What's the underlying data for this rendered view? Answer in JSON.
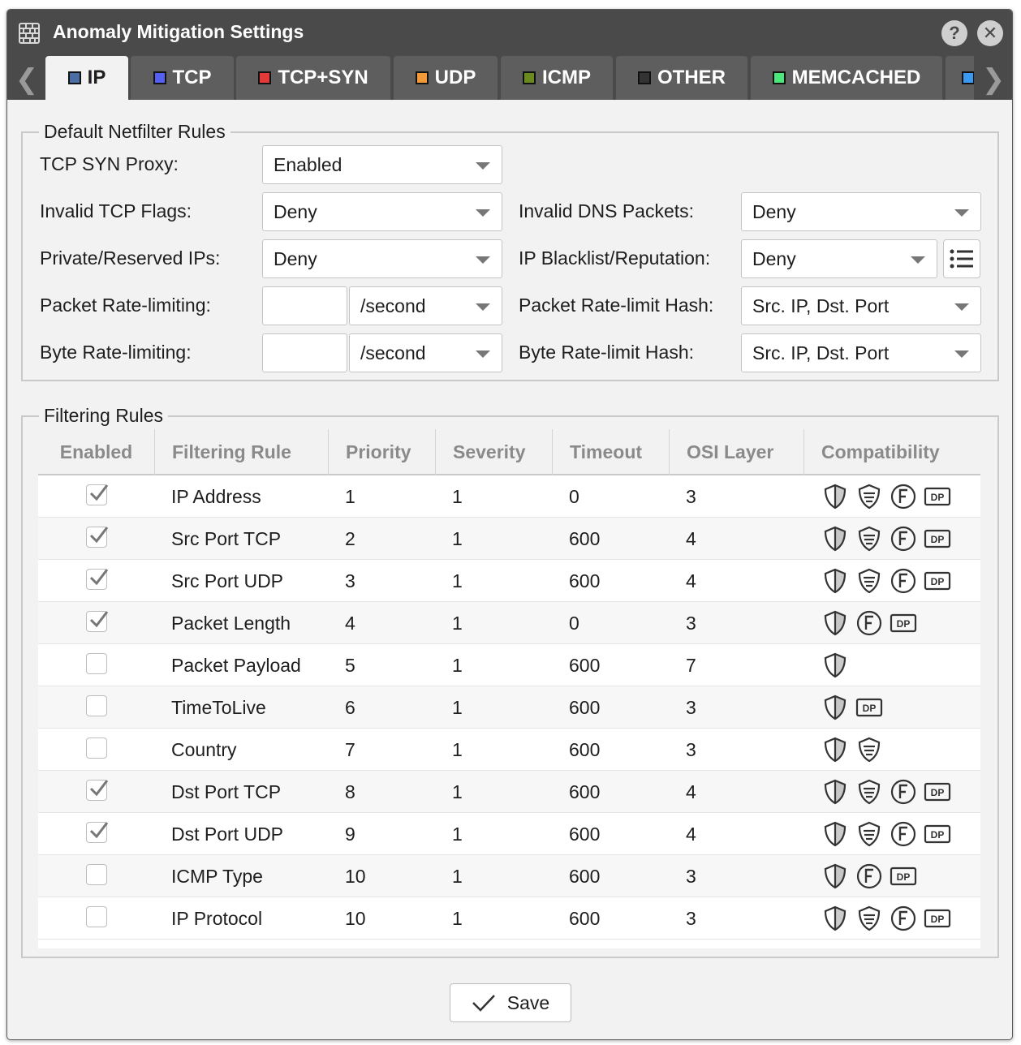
{
  "window": {
    "title": "Anomaly Mitigation Settings"
  },
  "titlebar": {
    "help_label": "?",
    "close_label": "✕"
  },
  "tabs": [
    {
      "label": "IP",
      "color": "#4a6ea3",
      "active": true
    },
    {
      "label": "TCP",
      "color": "#5560f0"
    },
    {
      "label": "TCP+SYN",
      "color": "#e23a3a"
    },
    {
      "label": "UDP",
      "color": "#f29a3a"
    },
    {
      "label": "ICMP",
      "color": "#6a8a1e"
    },
    {
      "label": "OTHER",
      "color": "#333333"
    },
    {
      "label": "MEMCACHED",
      "color": "#4ee67a"
    },
    {
      "label": "",
      "color": "#3a9af2"
    }
  ],
  "netfilter": {
    "legend": "Default Netfilter Rules",
    "tcp_syn_proxy": {
      "label": "TCP SYN Proxy:",
      "value": "Enabled"
    },
    "invalid_tcp_flags": {
      "label": "Invalid TCP Flags:",
      "value": "Deny"
    },
    "invalid_dns_packets": {
      "label": "Invalid DNS Packets:",
      "value": "Deny"
    },
    "private_reserved_ips": {
      "label": "Private/Reserved IPs:",
      "value": "Deny"
    },
    "ip_blacklist": {
      "label": "IP Blacklist/Reputation:",
      "value": "Deny"
    },
    "packet_rate_limiting": {
      "label": "Packet Rate-limiting:",
      "amount": "",
      "unit": "/second"
    },
    "packet_rate_limit_hash": {
      "label": "Packet Rate-limit Hash:",
      "value": "Src. IP, Dst. Port"
    },
    "byte_rate_limiting": {
      "label": "Byte Rate-limiting:",
      "amount": "",
      "unit": "/second"
    },
    "byte_rate_limit_hash": {
      "label": "Byte Rate-limit Hash:",
      "value": "Src. IP, Dst. Port"
    }
  },
  "filtering": {
    "legend": "Filtering Rules",
    "columns": [
      "Enabled",
      "Filtering Rule",
      "Priority",
      "Severity",
      "Timeout",
      "OSI Layer",
      "Compatibility"
    ],
    "rows": [
      {
        "enabled": true,
        "rule": "IP Address",
        "priority": "1",
        "severity": "1",
        "timeout": "0",
        "osi": "3",
        "compat": [
          "shield-icon",
          "filter-shield-icon",
          "f-circle-icon",
          "dp-icon"
        ]
      },
      {
        "enabled": true,
        "rule": "Src Port TCP",
        "priority": "2",
        "severity": "1",
        "timeout": "600",
        "osi": "4",
        "compat": [
          "shield-icon",
          "filter-shield-icon",
          "f-circle-icon",
          "dp-icon"
        ]
      },
      {
        "enabled": true,
        "rule": "Src Port UDP",
        "priority": "3",
        "severity": "1",
        "timeout": "600",
        "osi": "4",
        "compat": [
          "shield-icon",
          "filter-shield-icon",
          "f-circle-icon",
          "dp-icon"
        ]
      },
      {
        "enabled": true,
        "rule": "Packet Length",
        "priority": "4",
        "severity": "1",
        "timeout": "0",
        "osi": "3",
        "compat": [
          "shield-icon",
          "f-circle-icon",
          "dp-icon"
        ]
      },
      {
        "enabled": false,
        "rule": "Packet Payload",
        "priority": "5",
        "severity": "1",
        "timeout": "600",
        "osi": "7",
        "compat": [
          "shield-icon"
        ]
      },
      {
        "enabled": false,
        "rule": "TimeToLive",
        "priority": "6",
        "severity": "1",
        "timeout": "600",
        "osi": "3",
        "compat": [
          "shield-icon",
          "dp-icon"
        ]
      },
      {
        "enabled": false,
        "rule": "Country",
        "priority": "7",
        "severity": "1",
        "timeout": "600",
        "osi": "3",
        "compat": [
          "shield-icon",
          "filter-shield-icon"
        ]
      },
      {
        "enabled": true,
        "rule": "Dst Port TCP",
        "priority": "8",
        "severity": "1",
        "timeout": "600",
        "osi": "4",
        "compat": [
          "shield-icon",
          "filter-shield-icon",
          "f-circle-icon",
          "dp-icon"
        ]
      },
      {
        "enabled": true,
        "rule": "Dst Port UDP",
        "priority": "9",
        "severity": "1",
        "timeout": "600",
        "osi": "4",
        "compat": [
          "shield-icon",
          "filter-shield-icon",
          "f-circle-icon",
          "dp-icon"
        ]
      },
      {
        "enabled": false,
        "rule": "ICMP Type",
        "priority": "10",
        "severity": "1",
        "timeout": "600",
        "osi": "3",
        "compat": [
          "shield-icon",
          "f-circle-icon",
          "dp-icon"
        ]
      },
      {
        "enabled": false,
        "rule": "IP Protocol",
        "priority": "10",
        "severity": "1",
        "timeout": "600",
        "osi": "3",
        "compat": [
          "shield-icon",
          "filter-shield-icon",
          "f-circle-icon",
          "dp-icon"
        ]
      }
    ]
  },
  "footer": {
    "save_label": "Save"
  }
}
